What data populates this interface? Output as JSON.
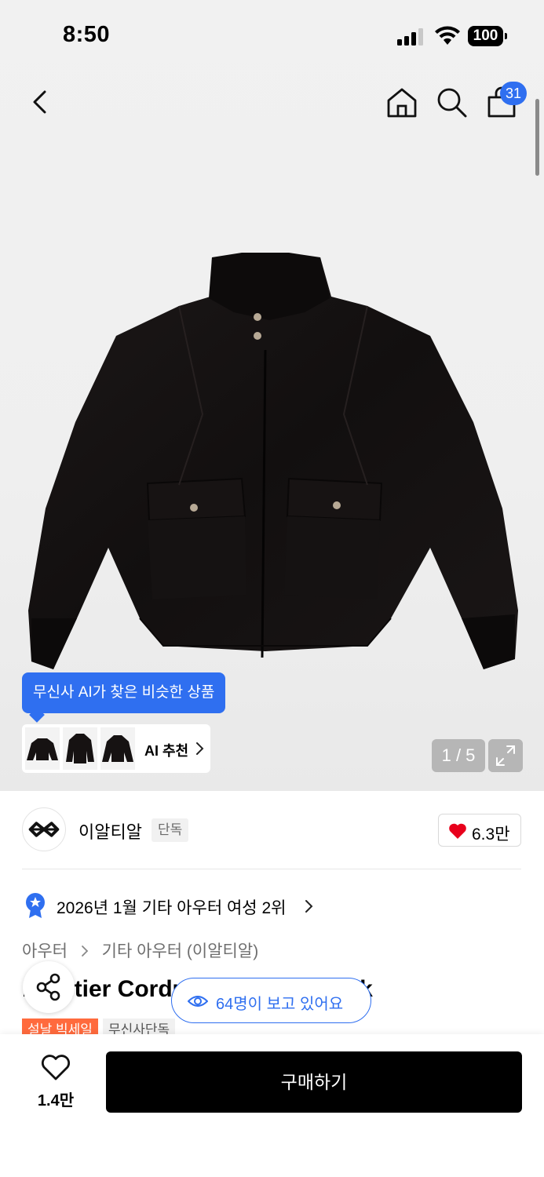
{
  "status_bar": {
    "time": "8:50",
    "battery": "100"
  },
  "header": {
    "cart_count": "31"
  },
  "gallery": {
    "ai_tooltip": "무신사 AI가 찾은 비슷한 상품",
    "ai_recommend_label": "AI 추천",
    "page_indicator": "1 / 5"
  },
  "brand": {
    "name": "이알티알",
    "tag": "단독",
    "likes": "6.3만"
  },
  "ranking": {
    "text": "2026년 1월 기타 아우터 여성 2위"
  },
  "breadcrumb": {
    "level1": "아우터",
    "level2": "기타 아우터 (이알티알)"
  },
  "product": {
    "title": "Frontier Corduroy Jacket Black",
    "tags": [
      "설날 빅세일",
      "무신사단독"
    ]
  },
  "viewers": {
    "text": "64명이 보고 있어요"
  },
  "bottom_bar": {
    "wish_count": "1.4만",
    "buy_label": "구매하기"
  },
  "colors": {
    "accent": "#2f6ff0",
    "sale": "#ff6a3d",
    "heart": "#e8001c"
  }
}
